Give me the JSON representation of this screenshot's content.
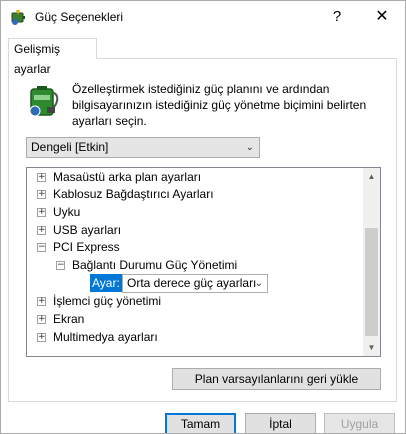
{
  "window": {
    "title": "Güç Seçenekleri",
    "icon": "power-options-icon",
    "help_glyph": "?",
    "close_glyph": "✕"
  },
  "tab": {
    "label": "Gelişmiş ayarlar"
  },
  "description": "Özelleştirmek istediğiniz güç planını ve ardından bilgisayarınızın istediğiniz güç yönetme biçimini belirten ayarları seçin.",
  "plan_dropdown": {
    "value": "Dengeli [Etkin]"
  },
  "tree": {
    "items": [
      {
        "label": "Masaüstü arka plan ayarları",
        "expander": "+"
      },
      {
        "label": "Kablosuz Bağdaştırıcı Ayarları",
        "expander": "+"
      },
      {
        "label": "Uyku",
        "expander": "+"
      },
      {
        "label": "USB ayarları",
        "expander": "+"
      },
      {
        "label": "PCI Express",
        "expander": "−"
      },
      {
        "label": "Bağlantı Durumu Güç Yönetimi",
        "expander": "−"
      },
      {
        "label": "İşlemci güç yönetimi",
        "expander": "+"
      },
      {
        "label": "Ekran",
        "expander": "+"
      },
      {
        "label": "Multimedya ayarları",
        "expander": "+"
      }
    ],
    "setting_label": "Ayar:",
    "setting_value": "Orta derece güç ayarları"
  },
  "buttons": {
    "restore": "Plan varsayılanlarını geri yükle",
    "ok": "Tamam",
    "cancel": "İptal",
    "apply": "Uygula"
  },
  "colors": {
    "selection": "#0078d7",
    "disabled_text": "#a0a0a0"
  }
}
